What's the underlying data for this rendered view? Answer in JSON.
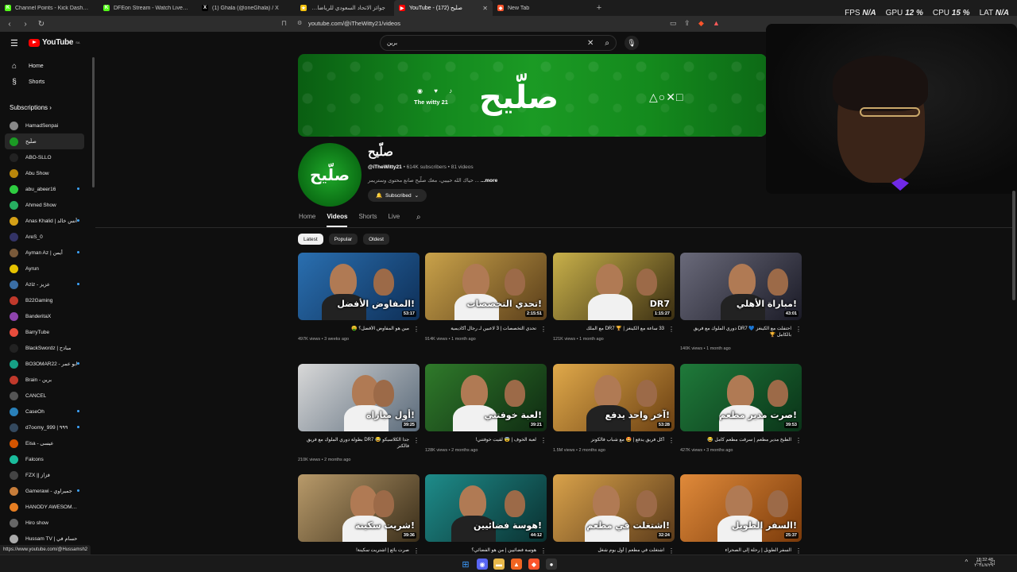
{
  "browser": {
    "tabs": [
      {
        "title": "Channel Points - Kick Dashboard",
        "color": "#53fc18",
        "glyph": "K"
      },
      {
        "title": "DFEon Stream - Watch Live on Kick",
        "color": "#53fc18",
        "glyph": "K"
      },
      {
        "title": "(1) Ghala (@oneGhala) / X",
        "color": "#000000",
        "glyph": "X"
      },
      {
        "title": "جوائز الاتحاد السعودي للرياضات الإلكترونية",
        "color": "#f4c20d",
        "glyph": "★"
      },
      {
        "title": "YouTube - صلّيح (172)",
        "color": "#ff0000",
        "glyph": "▶",
        "active": true
      },
      {
        "title": "New Tab",
        "color": "#fb542b",
        "glyph": "◆"
      }
    ],
    "url": "youtube.com/@iTheWitty21/videos",
    "status_url": "https://www.youtube.com/@Hussamsh2"
  },
  "overlay": {
    "fps_label": "FPS",
    "fps_value": "N/A",
    "gpu_label": "GPU",
    "gpu_value": "12 %",
    "cpu_label": "CPU",
    "cpu_value": "15 %",
    "lat_label": "LAT",
    "lat_value": "N/A"
  },
  "sidebar": {
    "logo": "YouTube",
    "logo_sup": "SA",
    "home": "Home",
    "shorts": "Shorts",
    "subscriptions": "Subscriptions ›",
    "channels": [
      {
        "name": "HamadSenpai",
        "color": "#888888",
        "dot": false
      },
      {
        "name": "صلّيح",
        "color": "#1b9a24",
        "dot": false,
        "selected": true
      },
      {
        "name": "ABO-SLLO",
        "color": "#222222",
        "dot": false
      },
      {
        "name": "Abu Show",
        "color": "#b8860b",
        "dot": false
      },
      {
        "name": "abu_abeer16",
        "color": "#2ecc40",
        "dot": true
      },
      {
        "name": "Ahmed Show",
        "color": "#27ae60",
        "dot": false
      },
      {
        "name": "Anas Khalid | أنس خالد",
        "color": "#d4a017",
        "dot": true
      },
      {
        "name": "AreS_0",
        "color": "#333366",
        "dot": false
      },
      {
        "name": "Ayman Az | أيمن",
        "color": "#7a5a3a",
        "dot": true
      },
      {
        "name": "Ayrun",
        "color": "#e6c200",
        "dot": false
      },
      {
        "name": "Aziz - عزيز",
        "color": "#3a6ea5",
        "dot": true
      },
      {
        "name": "B22Gaming",
        "color": "#c0392b",
        "dot": false
      },
      {
        "name": "BanderitaX",
        "color": "#8e44ad",
        "dot": false
      },
      {
        "name": "BarryTube",
        "color": "#e74c3c",
        "dot": false
      },
      {
        "name": "BlackSwordz | مبادح",
        "color": "#222222",
        "dot": false
      },
      {
        "name": "BO3OMAR22 - ابو عمر",
        "color": "#16a085",
        "dot": true
      },
      {
        "name": "Brain - برين",
        "color": "#c0392b",
        "dot": false
      },
      {
        "name": "CANCEL",
        "color": "#555555",
        "dot": false
      },
      {
        "name": "CaseOh",
        "color": "#2980b9",
        "dot": true
      },
      {
        "name": "d7oomy_999 | ٩٩٩",
        "color": "#34495e",
        "dot": true
      },
      {
        "name": "Eisa - عيسى",
        "color": "#d35400",
        "dot": false
      },
      {
        "name": "Falcons",
        "color": "#1abc9c",
        "dot": false
      },
      {
        "name": "FZX || فزاز",
        "color": "#444444",
        "dot": false
      },
      {
        "name": "Gamerawi - جميراوي",
        "color": "#c77d3a",
        "dot": true
      },
      {
        "name": "HANODY AWESOME...",
        "color": "#e67e22",
        "dot": false
      },
      {
        "name": "Hiro show",
        "color": "#666666",
        "dot": false
      },
      {
        "name": "Hussam TV | حسام في",
        "color": "#aaaaaa",
        "dot": false
      }
    ]
  },
  "search": {
    "value": "برين"
  },
  "banner": {
    "logo": "صلّيح",
    "handle": "The witty 21",
    "social": "◉ ♥ ♪",
    "ps": "△○✕□"
  },
  "channel": {
    "name": "صلّيح",
    "handle": "@iTheWitty21",
    "meta": "614K subscribers • 81 videos",
    "description": "حياك الله حبيبي، معك صلّيح صانع محتوى وستريمر ...",
    "more": "...more",
    "subscribed": "Subscribed",
    "avatar_text": "صلّيح"
  },
  "tabs": [
    "Home",
    "Videos",
    "Shorts",
    "Live"
  ],
  "active_tab": "Videos",
  "chips": [
    "Latest",
    "Popular",
    "Oldest"
  ],
  "active_chip": "Latest",
  "videos": [
    {
      "title": "مين هو المفاوض الأفضل؟ 🤑",
      "views": "497K views",
      "age": "3 weeks ago",
      "duration": "53:17",
      "cap": "المفاوض الأفضل!",
      "bg": "#2a6fb0",
      "bg2": "#0e2f57"
    },
    {
      "title": "تحدي التخصصات | 3 لاعبين لـ رجال أكاديمية",
      "views": "914K views",
      "age": "1 month ago",
      "duration": "2:15:51",
      "cap": "تحدي التخصصات!",
      "bg": "#c9a24a",
      "bg2": "#5a3e1a"
    },
    {
      "title": "33 ساعة مع الكينغز | 🏆 DR7 مع الملك",
      "views": "121K views",
      "age": "1 month ago",
      "duration": "1:15:27",
      "cap": "DR7",
      "bg": "#c8b04a",
      "bg2": "#3a2e12"
    },
    {
      "title": "احتفلت مع الكينغز 💙 DR7 دوري الملوك مع فريق بالكامل 🏆",
      "views": "140K views",
      "age": "1 month ago",
      "duration": "43:01",
      "cap": "مباراة الأهلي!",
      "bg": "#6a6a7a",
      "bg2": "#1a1a26"
    },
    {
      "title": "جداً الكلاسيكو 😂 DR7 بطولة دوري الملوك مع فريق فالكنز",
      "views": "210K views",
      "age": "2 months ago",
      "duration": "39:25",
      "cap": "أول مباراة!",
      "bg": "#d8d8d8",
      "bg2": "#5a6a7a"
    },
    {
      "title": "لعبة الخوف | 😨 لقيت خوفتني!",
      "views": "128K views",
      "age": "2 months ago",
      "duration": "39:21",
      "cap": "لعبة خوفتني!",
      "bg": "#2f7a2a",
      "bg2": "#0f2a12"
    },
    {
      "title": "أكل فريق يدفع | 🤩 مع شباب فالكونز",
      "views": "1.5M views",
      "age": "2 months ago",
      "duration": "53:28",
      "cap": "آخر واحد يدفع!",
      "bg": "#e0a94a",
      "bg2": "#6a3f12"
    },
    {
      "title": "الطبخ مدير مطعم | سرقت مطعم كامل 😂",
      "views": "427K views",
      "age": "3 months ago",
      "duration": "39:53",
      "cap": "صرت مدير مطعم!",
      "bg": "#1f7a3a",
      "bg2": "#0a3318"
    },
    {
      "title": "صرت بائع | اشتريت سكينة!",
      "views": "",
      "age": "",
      "duration": "39:36",
      "cap": "شريت سكينة!",
      "bg": "#b89a6a",
      "bg2": "#3a2e1a"
    },
    {
      "title": "هوسة فضائيين | من هو الفضائي؟",
      "views": "",
      "age": "",
      "duration": "44:12",
      "cap": "هوسة فضائيين!",
      "bg": "#1e8c8a",
      "bg2": "#0a3030"
    },
    {
      "title": "اشتغلت في مطعم | أول يوم شغل",
      "views": "",
      "age": "",
      "duration": "32:24",
      "cap": "اشتغلت في مطعم!",
      "bg": "#d9a24a",
      "bg2": "#5a3a1a"
    },
    {
      "title": "السفر الطويل | رحلة إلى الصحراء",
      "views": "",
      "age": "",
      "duration": "25:37",
      "cap": "السفر الطويل!",
      "bg": "#e08a3a",
      "bg2": "#7a3a0a"
    }
  ],
  "clock": {
    "time": "18:32:48",
    "date": "٢٠٢٤/٧/٢٩"
  }
}
